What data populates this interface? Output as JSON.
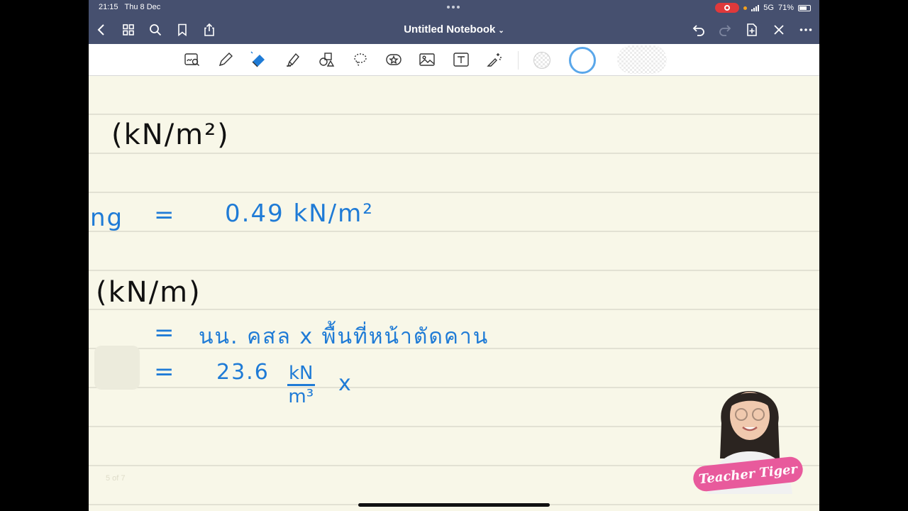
{
  "status_bar": {
    "time": "21:15",
    "date": "Thu 8 Dec",
    "network": "5G",
    "battery": "71%",
    "battery_level": 0.71
  },
  "nav": {
    "title": "Untitled Notebook",
    "icons": [
      "back-icon",
      "grid-icon",
      "search-icon",
      "bookmark-icon",
      "share-icon",
      "undo-icon",
      "redo-icon",
      "add-page-icon",
      "close-icon",
      "more-icon"
    ]
  },
  "toolbar": {
    "tools": [
      "zoom-window-icon",
      "pen-icon",
      "eraser-icon",
      "highlighter-icon",
      "shapes-icon",
      "lasso-icon",
      "sticker-icon",
      "image-icon",
      "text-icon",
      "laser-pointer-icon"
    ],
    "colors": {
      "accent": "#1f7bd6",
      "topbar": "#46506f",
      "paper": "#f8f7e8"
    }
  },
  "notes": {
    "heading1": "(kN/m²)",
    "row1_left": "ng",
    "row1_eq": "=",
    "row1_value": "0.49 kN/m²",
    "heading2": "(kN/m)",
    "row2_eq": "=",
    "row2_text": "นน. คสล x พื้นที่หน้าตัดคาน",
    "row3_eq": "=",
    "row3_value": "23.6",
    "row3_num": "kN",
    "row3_den": "m³",
    "row3_x": "x"
  },
  "page_indicator": "5 of 7",
  "webcam": {
    "brand": "Teacher Tiger"
  }
}
